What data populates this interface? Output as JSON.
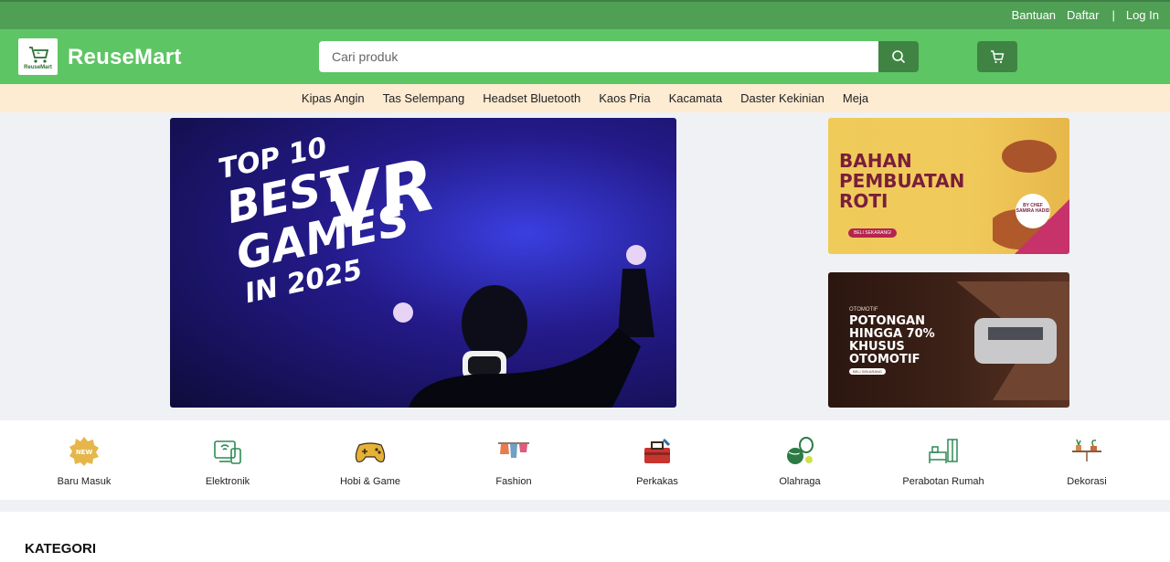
{
  "topbar": {
    "help": "Bantuan",
    "register": "Daftar",
    "separator": "|",
    "login": "Log In"
  },
  "header": {
    "logo_text": "ReuseMart",
    "brand": "ReuseMart",
    "search_placeholder": "Cari produk",
    "accent": "#5ec564",
    "dark_accent": "#3f8443"
  },
  "suggestions": [
    "Kipas Angin",
    "Tas Selempang",
    "Headset Bluetooth",
    "Kaos Pria",
    "Kacamata",
    "Daster Kekinian",
    "Meja"
  ],
  "hero": {
    "line1": "TOP 10",
    "line2": "BEST",
    "line3": "GAMES",
    "line4": "IN 2025",
    "vr": "VR"
  },
  "promo1": {
    "title1": "BAHAN",
    "title2": "PEMBUATAN",
    "title3": "ROTI",
    "cta": "BELI SEKARANG!",
    "chef": "BY CHEF SAMIRA HADID"
  },
  "promo2": {
    "kicker": "OTOMOTIF",
    "title1": "POTONGAN",
    "title2": "HINGGA 70%",
    "title3": "KHUSUS",
    "title4": "OTOMOTIF",
    "cta": "BELI SEKARANG"
  },
  "categories": [
    {
      "label": "Baru Masuk",
      "icon": "new-badge-icon"
    },
    {
      "label": "Elektronik",
      "icon": "electronics-icon"
    },
    {
      "label": "Hobi & Game",
      "icon": "gamepad-icon"
    },
    {
      "label": "Fashion",
      "icon": "clothes-icon"
    },
    {
      "label": "Perkakas",
      "icon": "toolbox-icon"
    },
    {
      "label": "Olahraga",
      "icon": "sports-icon"
    },
    {
      "label": "Perabotan Rumah",
      "icon": "furniture-icon"
    },
    {
      "label": "Dekorasi",
      "icon": "decoration-icon"
    }
  ],
  "section": {
    "title": "KATEGORI"
  }
}
